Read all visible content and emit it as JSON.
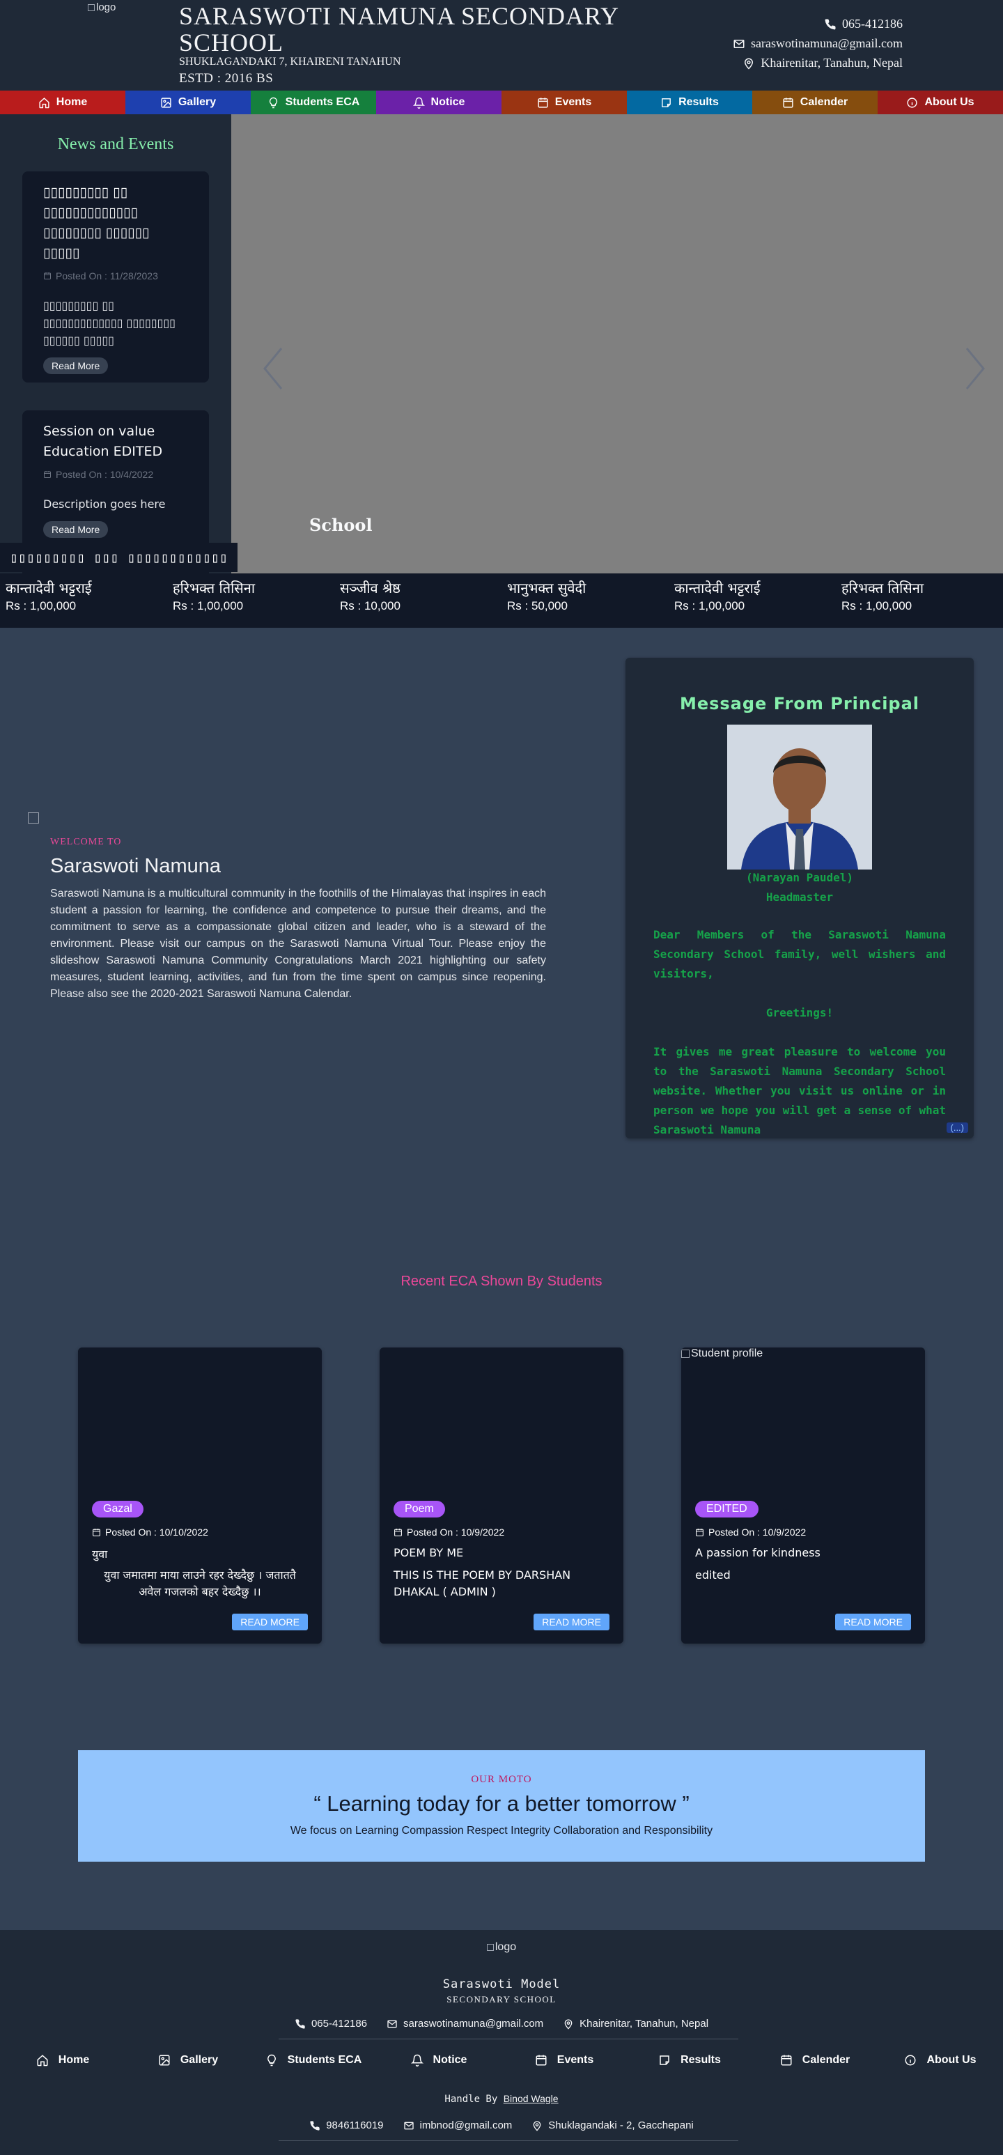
{
  "header": {
    "logo_alt": "logo",
    "school_name": "SARASWOTI NAMUNA SECONDARY SCHOOL",
    "address": "SHUKLAGANDAKI 7, KHAIRENI TANAHUN",
    "estd": "ESTD : 2016 BS",
    "phone": "065-412186",
    "email": "saraswotinamuna@gmail.com",
    "location": "Khairenitar, Tanahun, Nepal"
  },
  "nav": [
    {
      "label": "Home",
      "color": "#b91c1c",
      "icon": "home-icon"
    },
    {
      "label": "Gallery",
      "color": "#1e40af",
      "icon": "image-icon"
    },
    {
      "label": "Students ECA",
      "color": "#15803d",
      "icon": "lightbulb-icon"
    },
    {
      "label": "Notice",
      "color": "#6b21a8",
      "icon": "bell-icon"
    },
    {
      "label": "Events",
      "color": "#9a3412",
      "icon": "calendar-icon"
    },
    {
      "label": "Results",
      "color": "#0369a1",
      "icon": "note-icon"
    },
    {
      "label": "Calender",
      "color": "#854d0e",
      "icon": "calendar-icon"
    },
    {
      "label": "About Us",
      "color": "#991b1b",
      "icon": "info-icon"
    }
  ],
  "news": {
    "title": "News and Events",
    "items": [
      {
        "title": "▯▯▯▯▯▯▯▯▯ ▯▯ ▯▯▯▯▯▯▯▯▯▯▯▯▯ ▯▯▯▯▯▯▯▯ ▯▯▯▯▯▯ ▯▯▯▯▯",
        "posted": "Posted On : 11/28/2023",
        "desc": "▯▯▯▯▯▯▯▯▯ ▯▯ ▯▯▯▯▯▯▯▯▯▯▯▯▯ ▯▯▯▯▯▯▯▯ ▯▯▯▯▯▯ ▯▯▯▯▯",
        "button": "Read More"
      },
      {
        "title": "Session on value Education EDITED",
        "posted": "Posted On : 10/4/2022",
        "desc": "Description goes here",
        "button": "Read More"
      }
    ]
  },
  "slider": {
    "caption": "School"
  },
  "donors": {
    "label": "▯▯▯▯▯▯▯▯▯ ▯▯▯ ▯▯▯▯▯▯▯▯▯▯▯▯",
    "items": [
      {
        "name": "कान्तादेवी भट्टराई",
        "amount": "Rs : 1,00,000"
      },
      {
        "name": "हरिभक्त तिसिना",
        "amount": "Rs : 1,00,000"
      },
      {
        "name": "सञ्जीव श्रेष्ठ",
        "amount": "Rs : 10,000"
      },
      {
        "name": "भानुभक्त सुवेदी",
        "amount": "Rs : 50,000"
      },
      {
        "name": "कान्तादेवी भट्टराई",
        "amount": "Rs : 1,00,000"
      },
      {
        "name": "हरिभक्त तिसिना",
        "amount": "Rs : 1,00,000"
      }
    ]
  },
  "welcome": {
    "tag": "WELCOME TO",
    "title": "Saraswoti Namuna",
    "text": "Saraswoti Namuna is a multicultural community in the foothills of the Himalayas that inspires in each student a passion for learning, the confidence and competence to pursue their dreams, and the commitment to serve as a compassionate global citizen and leader, who is a steward of the environment. Please visit our campus on the Saraswoti Namuna Virtual Tour. Please enjoy the slideshow Saraswoti Namuna Community Congratulations March 2021 highlighting our safety measures, student learning, activities, and fun from the time spent on campus since reopening. Please also see the 2020-2021 Saraswoti Namuna Calendar."
  },
  "principal": {
    "title": "Message From Principal",
    "name": "(Narayan Paudel)",
    "role": "Headmaster",
    "p1": "Dear Members of the Saraswoti Namuna Secondary School family, well wishers and visitors,",
    "p2": "Greetings!",
    "p3": "It gives me great pleasure to welcome you to the Saraswoti Namuna Secondary School website. Whether you visit us online or in person we hope you will get a sense of what Saraswoti Namuna",
    "more": "(...)"
  },
  "eca": {
    "title": "Recent ECA Shown By Students",
    "cards": [
      {
        "img_alt": "",
        "tag": "Gazal",
        "posted": "Posted On : 10/10/2022",
        "heading": "युवा",
        "body": "युवा जमातमा माया लाउने रहर देख्दैछु । जताततै अवेल गजलको बहर देख्दैछु ।।",
        "button": "READ MORE"
      },
      {
        "img_alt": "",
        "tag": "Poem",
        "posted": "Posted On : 10/9/2022",
        "heading": "POEM BY ME",
        "body": "THIS IS THE POEM BY DARSHAN DHAKAL ( ADMIN )",
        "button": "READ MORE"
      },
      {
        "img_alt": "Student profile",
        "tag": "EDITED",
        "posted": "Posted On : 10/9/2022",
        "heading": "A passion for kindness",
        "body": "edited",
        "button": "READ MORE"
      }
    ]
  },
  "moto": {
    "tag": "OUR MOTO",
    "quote": "“ Learning today for a better tomorrow ”",
    "sub": "We focus on Learning Compassion Respect Integrity Collaboration and Responsibility"
  },
  "footer": {
    "logo_alt": "logo",
    "name": "Saraswoti Model",
    "sub": "SECONDARY SCHOOL",
    "phone": "065-412186",
    "email": "saraswotinamuna@gmail.com",
    "location": "Khairenitar, Tanahun, Nepal",
    "nav": [
      "Home",
      "Gallery",
      "Students ECA",
      "Notice",
      "Events",
      "Results",
      "Calender",
      "About Us"
    ],
    "handle_prefix": "Handle By",
    "handle_name": "Binod Wagle",
    "dev_phone": "9846116019",
    "dev_email": "imbnod@gmail.com",
    "dev_location": "Shuklagandaki - 2, Gacchepani"
  }
}
